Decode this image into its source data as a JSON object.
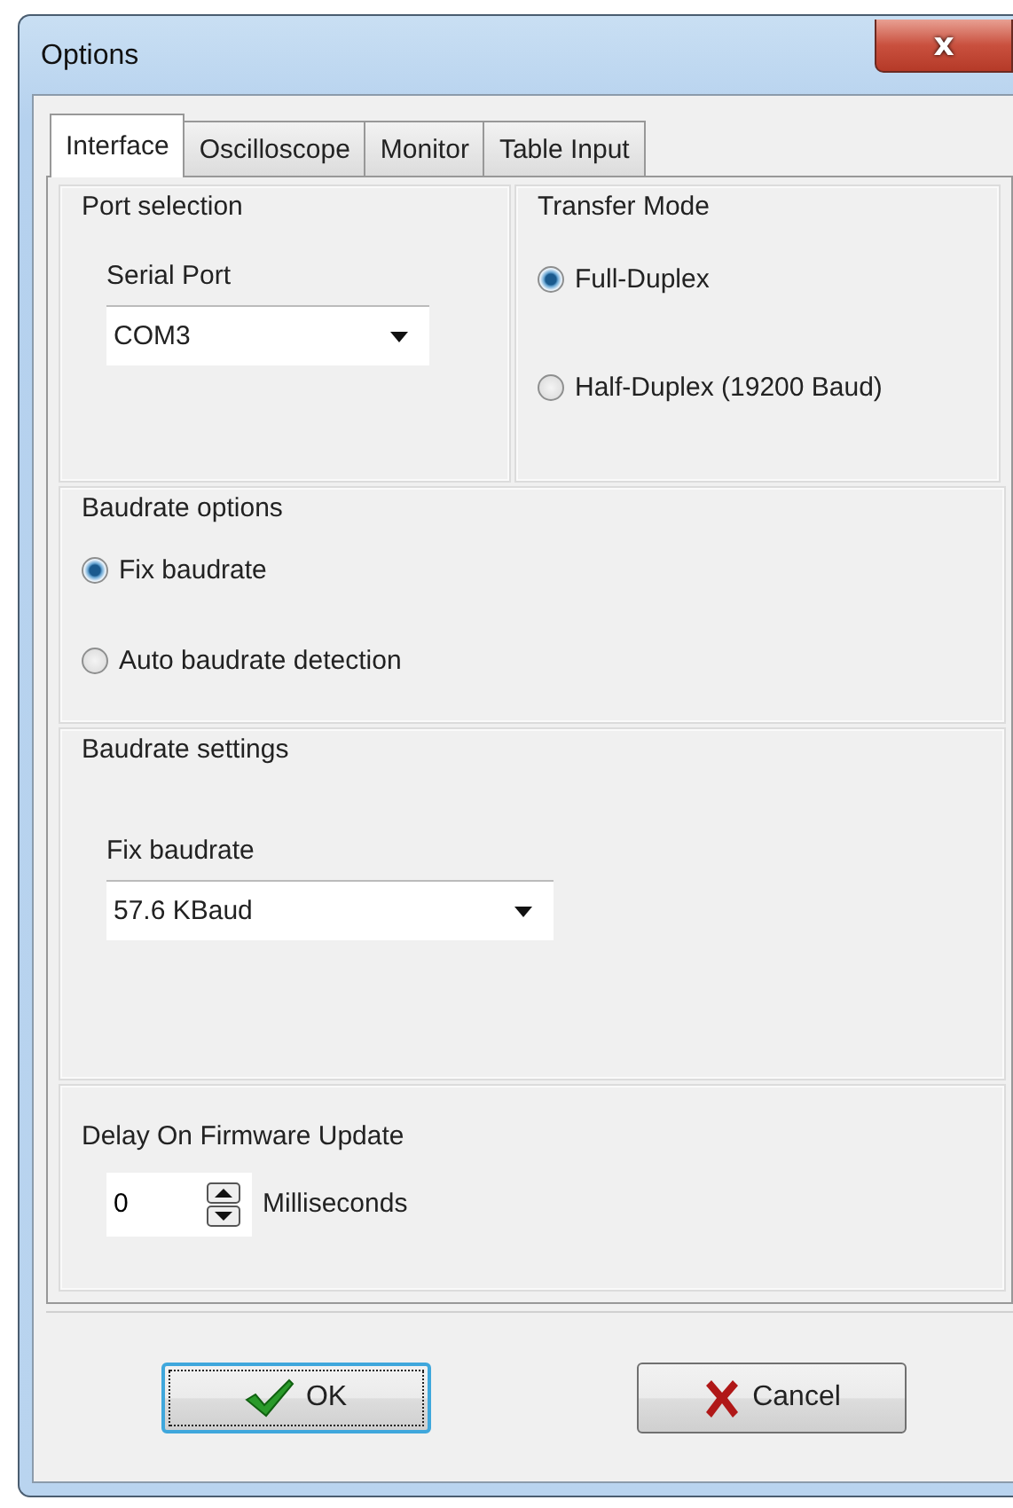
{
  "window": {
    "title": "Options",
    "close": "x"
  },
  "tabs": [
    {
      "label": "Interface",
      "selected": true
    },
    {
      "label": "Oscilloscope",
      "selected": false
    },
    {
      "label": "Monitor",
      "selected": false
    },
    {
      "label": "Table Input",
      "selected": false
    }
  ],
  "port_selection": {
    "title": "Port selection",
    "label": "Serial Port",
    "value": "COM3"
  },
  "transfer_mode": {
    "title": "Transfer Mode",
    "options": [
      {
        "label": "Full-Duplex",
        "selected": true
      },
      {
        "label": "Half-Duplex (19200 Baud)",
        "selected": false
      }
    ]
  },
  "baudrate_options": {
    "title": "Baudrate options",
    "options": [
      {
        "label": "Fix baudrate",
        "selected": true
      },
      {
        "label": "Auto baudrate detection",
        "selected": false
      }
    ]
  },
  "baudrate_settings": {
    "title": "Baudrate settings",
    "label": "Fix baudrate",
    "value": "57.6 KBaud"
  },
  "firmware_delay": {
    "title": "Delay On Firmware Update",
    "value": "0",
    "unit": "Milliseconds"
  },
  "buttons": [
    {
      "kind": "ok",
      "label": "OK",
      "focused": true
    },
    {
      "kind": "cancel",
      "label": "Cancel",
      "focused": false
    }
  ]
}
